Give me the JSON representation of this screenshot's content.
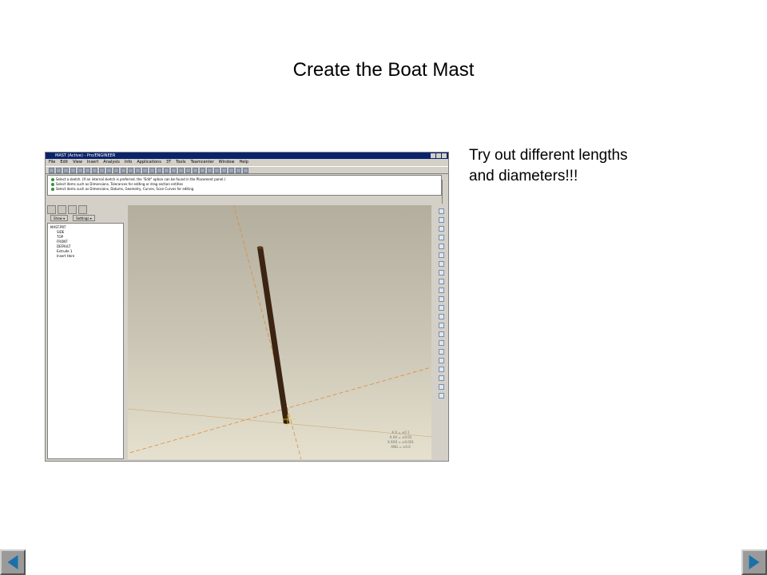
{
  "slide": {
    "title": "Create the Boat Mast",
    "note_line1": "Try out different lengths",
    "note_line2": "and diameters!!!"
  },
  "app": {
    "window_title": "MAST (Active) - Pro/ENGINEER",
    "menu": [
      "File",
      "Edit",
      "View",
      "Insert",
      "Analysis",
      "Info",
      "Applications",
      "3T",
      "Tools",
      "Teamcenter",
      "Window",
      "Help"
    ],
    "messages": [
      "Select a sketch. (If an internal sketch is preferred, the \"Edit\" option can be found in the Placement panel.)",
      "Select items such as Dimensions, Tolerances for editing or drag section entities",
      "Select items such as Dimensions, Datums, Geometry, Curves, Scan Curves for editing"
    ],
    "show_label": "Show ▾",
    "settings_label": "Settings ▾",
    "tree": [
      "MAST.PRT",
      "SIDE",
      "TOP",
      "FRONT",
      "DEFAULT",
      "Extrude 1",
      "Insert Here"
    ],
    "tolerances": [
      "X.X = ±0.1",
      "X.XX = ±0.01",
      "X.XXX = ±0.001",
      "ANG = ±0.0"
    ]
  },
  "colors": {
    "mast": "#3b2412",
    "nav_arrow": "#1b70a9"
  },
  "icons": {
    "prev": "triangle-left-icon",
    "next": "triangle-right-icon"
  }
}
